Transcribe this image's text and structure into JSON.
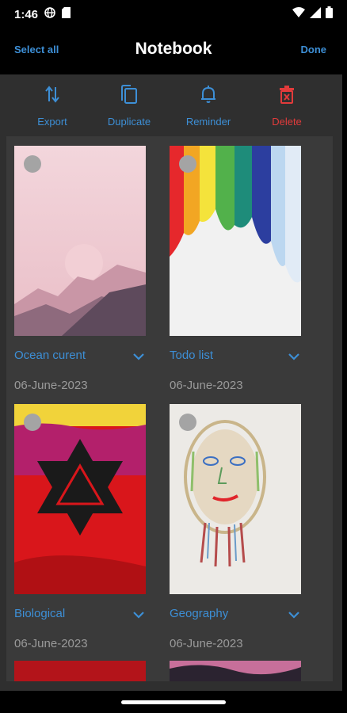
{
  "status_bar": {
    "time": "1:46"
  },
  "header": {
    "select_all": "Select all",
    "title": "Notebook",
    "done": "Done"
  },
  "toolbar": {
    "export": "Export",
    "duplicate": "Duplicate",
    "reminder": "Reminder",
    "delete": "Delete"
  },
  "notes": [
    {
      "name": "Ocean curent",
      "date": "06-June-2023"
    },
    {
      "name": "Todo list",
      "date": "06-June-2023"
    },
    {
      "name": "Biological",
      "date": "06-June-2023"
    },
    {
      "name": "Geography",
      "date": "06-June-2023"
    }
  ],
  "colors": {
    "accent": "#3d8fd6",
    "delete": "#e23b3b",
    "panel": "#2f2f2f",
    "grid": "#3a3a3a"
  }
}
